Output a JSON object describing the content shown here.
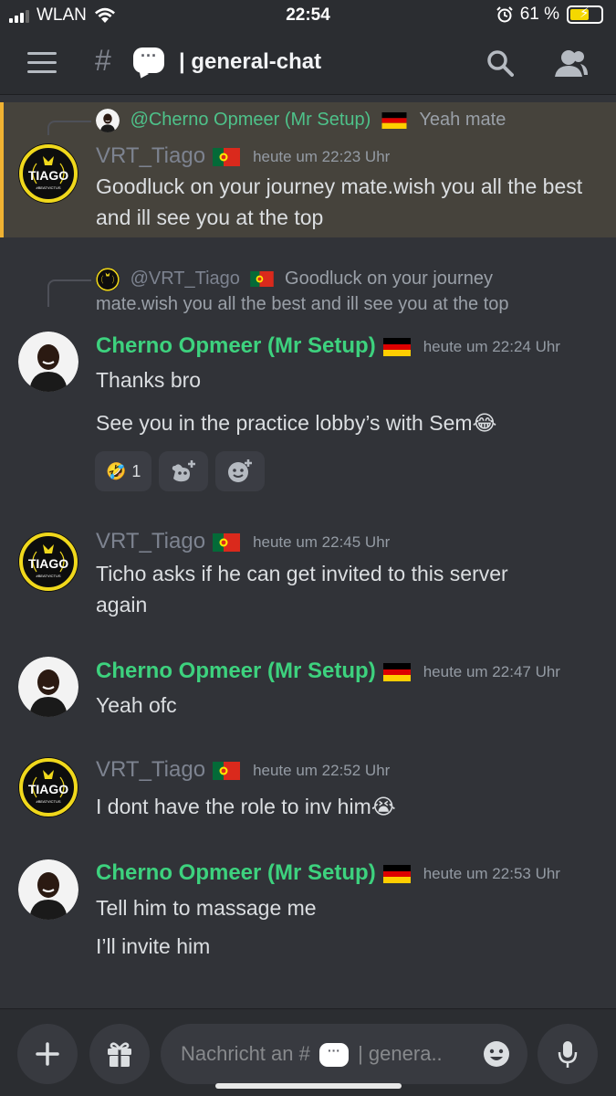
{
  "status_bar": {
    "carrier": "WLAN",
    "time": "22:54",
    "battery": "61 %",
    "battery_fraction": 0.61
  },
  "header": {
    "hash": "#",
    "channel_emoji": "···",
    "channel_name": "| general-chat",
    "icons": [
      "hamburger-icon",
      "search-icon",
      "members-icon"
    ]
  },
  "messages": [
    {
      "reply_to": {
        "mention": "@Cherno Opmeer (Mr Setup)",
        "flag": "de",
        "excerpt": "Yeah mate"
      },
      "author": "VRT_Tiago",
      "flag": "pt",
      "timestamp": "heute um 22:23 Uhr",
      "lines": [
        "Goodluck on your journey mate.wish you all the best and ill see you at the top"
      ],
      "highlighted": true
    },
    {
      "reply_to": {
        "mention": "@VRT_Tiago",
        "flag": "pt",
        "excerpt_line1": "Goodluck on your journey",
        "excerpt_line2": "mate.wish you all the best and ill see you at the top"
      },
      "author": "Cherno Opmeer (Mr Setup)",
      "flag": "de",
      "timestamp": "heute um 22:24 Uhr",
      "lines": [
        "Thanks bro",
        "See you in the practice lobby’s with Sem😂"
      ],
      "reactions": [
        {
          "emoji": "🤣",
          "count": "1"
        },
        {
          "icon": "add-reaction-icon"
        },
        {
          "icon": "add-super-reaction-icon"
        }
      ]
    },
    {
      "author": "VRT_Tiago",
      "flag": "pt",
      "timestamp": "heute um 22:45 Uhr",
      "lines": [
        "Ticho asks if he can get invited to this server",
        "again"
      ]
    },
    {
      "author": "Cherno Opmeer (Mr Setup)",
      "flag": "de",
      "timestamp": "heute um 22:47 Uhr",
      "lines": [
        "Yeah ofc"
      ]
    },
    {
      "author": "VRT_Tiago",
      "flag": "pt",
      "timestamp": "heute um 22:52 Uhr",
      "lines": [
        "I dont have the role to inv him😭"
      ]
    },
    {
      "author": "Cherno Opmeer (Mr Setup)",
      "flag": "de",
      "timestamp": "heute um 22:53 Uhr",
      "lines": [
        "Tell him to massage me",
        "I’ll invite him"
      ]
    }
  ],
  "avatar_text": {
    "tiago": "TIAGO",
    "tiago_sub": "#BEATVICTUS"
  },
  "composer": {
    "placeholder_prefix": "Nachricht an #",
    "placeholder_suffix": "| genera..",
    "buttons": [
      "plus-icon",
      "gift-icon",
      "emoji-icon",
      "microphone-icon"
    ]
  },
  "colors": {
    "background": "#313338",
    "header": "#2b2d31",
    "highlight": "#46433c",
    "highlight_bar": "#f0b232",
    "cherno_name": "#3dd27e",
    "tiago_name": "#7d8390",
    "mention": "#4ec28a"
  }
}
